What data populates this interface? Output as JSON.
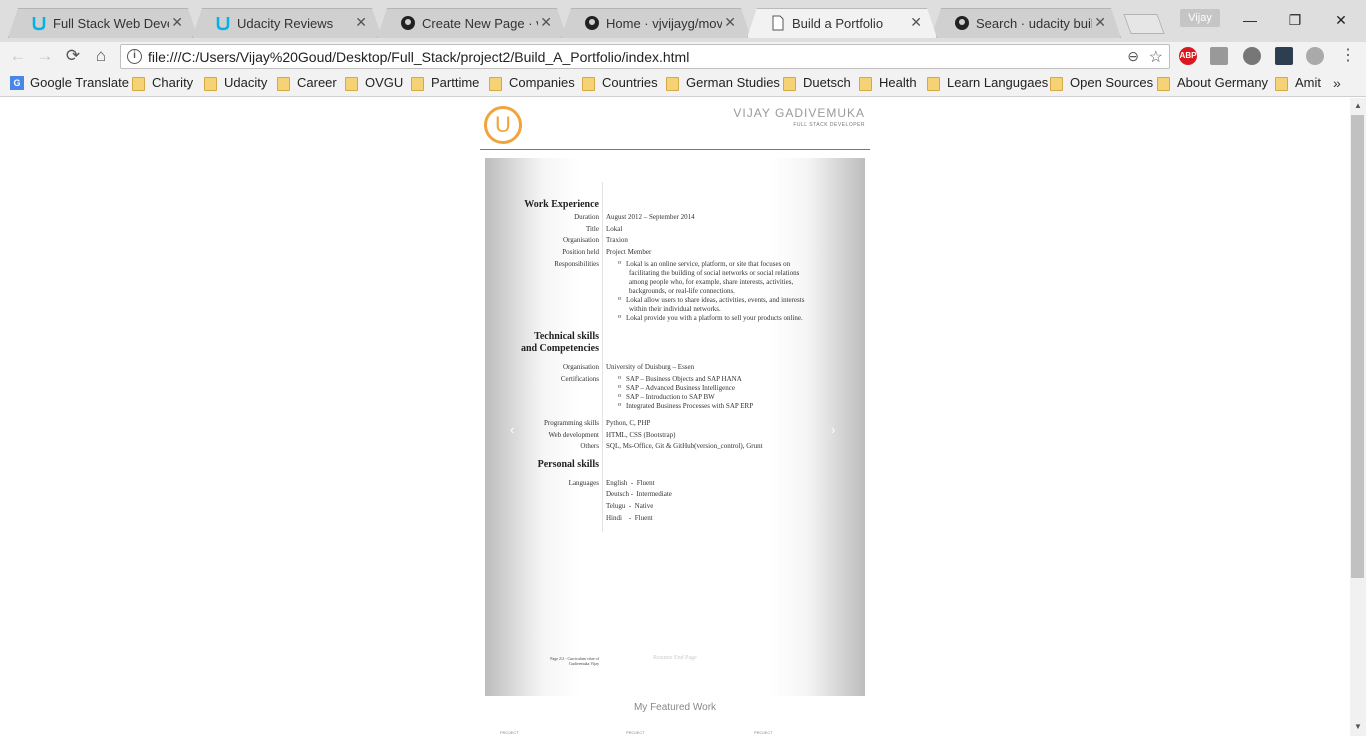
{
  "browser": {
    "tabs": [
      {
        "title": "Full Stack Web Develop",
        "icon": "udacity-icon"
      },
      {
        "title": "Udacity Reviews",
        "icon": "udacity-icon"
      },
      {
        "title": "Create New Page · vjvija",
        "icon": "github-icon"
      },
      {
        "title": "Home · vjvijayg/movie_",
        "icon": "github-icon"
      },
      {
        "title": "Build a Portfolio",
        "icon": "page-icon"
      },
      {
        "title": "Search · udacity build a",
        "icon": "github-icon"
      }
    ],
    "close_glyph": "✕",
    "user": "Vijay",
    "url": "file:///C:/Users/Vijay%20Goud/Desktop/Full_Stack/project2/Build_A_Portfolio/index.html",
    "window_controls": {
      "minimize": "—",
      "restore": "❐",
      "close": "✕"
    },
    "nav": {
      "back": "←",
      "forward": "→",
      "reload": "⟳",
      "home": "⌂"
    },
    "extensions": {
      "abp": "ABP"
    },
    "bookmarks": [
      "Google Translate",
      "Charity",
      "Udacity",
      "Career",
      "OVGU",
      "Parttime",
      "Companies",
      "Countries",
      "German Studies",
      "Duetsch",
      "Health",
      "Learn Langugaes",
      "Open Sources",
      "About Germany",
      "Amit"
    ],
    "bookmarks_more": "»"
  },
  "header": {
    "logo_letter": "U",
    "name": "VIJAY GADIVEMUKA",
    "role": "FULL STACK DEVELOPER"
  },
  "carousel": {
    "prev": "‹",
    "next": "›"
  },
  "cv": {
    "work": {
      "title": "Work Experience",
      "rows": [
        {
          "label": "Duration",
          "value": "August 2012 – September 2014"
        },
        {
          "label": "Title",
          "value": "Lokal"
        },
        {
          "label": "Organisation",
          "value": "Traxion"
        },
        {
          "label": "Position held",
          "value": "Project Member"
        },
        {
          "label": "Responsibilities",
          "value": ""
        }
      ],
      "responsibilities": [
        "Lokal is an online service, platform, or site that focuses on",
        "facilitating the building of social networks or social relations",
        "among people who, for example, share interests, activities,",
        "backgrounds, or real-life connections.",
        "Lokal allow users to share ideas, activities, events, and interests",
        "within their individual networks.",
        "Lokal provide you with a platform to sell your products online."
      ]
    },
    "tech": {
      "title_line1": "Technical skills",
      "title_line2": "and Competencies",
      "org_label": "Organisation",
      "org_value": "University of Duisburg – Essen",
      "cert_label": "Certifications",
      "certs": [
        "SAP – Business Objects and SAP HANA",
        "SAP – Advanced Business Intelligence",
        "SAP – Introduction to SAP BW",
        "Integrated Business Processes with SAP ERP"
      ],
      "skills": [
        {
          "label": "Programming skills",
          "value": "Python, C, PHP"
        },
        {
          "label": "Web development",
          "value": "HTML, CSS (Bootstrap)"
        },
        {
          "label": "Others",
          "value": "SQL, Ms-Office, Git & GitHub(version_control), Grunt"
        }
      ]
    },
    "personal": {
      "title": "Personal skills",
      "lang_label": "Languages",
      "languages": [
        "English  -  Fluent",
        "Deutsch -  Intermediate",
        "Telugu  -  Native",
        "Hindi    -  Fluent"
      ]
    },
    "footer_left": "Page 2/2 - Curriculum vitae of Gadivemuka Vijay",
    "footer_center": "Resume End Page"
  },
  "featured": {
    "title": "My Featured Work",
    "projects": [
      "PROJECT",
      "PROJECT",
      "PROJECT"
    ]
  }
}
